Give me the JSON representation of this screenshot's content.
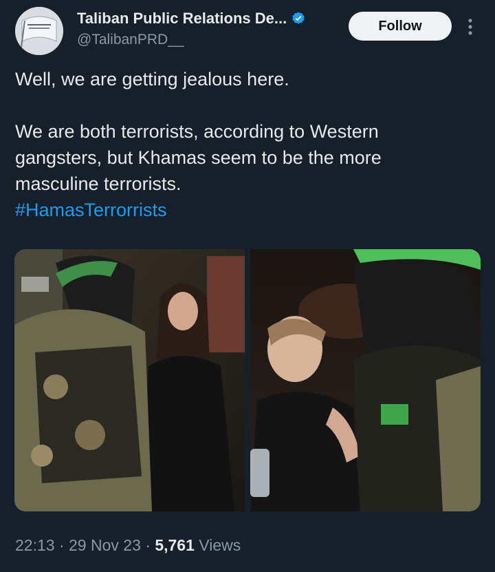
{
  "tweet": {
    "display_name": "Taliban Public Relations De...",
    "handle": "@TalibanPRD__",
    "follow_label": "Follow",
    "paragraphs": [
      "Well, we are getting jealous here.",
      "We are both terrorists, according to Western gangsters, but Khamas seem to be the more masculine terrorists."
    ],
    "hashtag": "#HamasTerrorrists",
    "time": "22:13",
    "date": "29 Nov 23",
    "separator": "·",
    "views_count": "5,761",
    "views_label": "Views"
  },
  "colors": {
    "background": "#15202b",
    "text": "#e7e9ea",
    "muted": "#8b98a5",
    "link": "#1d9bf0",
    "verified": "#1d9bf0"
  },
  "icons": [
    "avatar-flag-icon",
    "verified-badge-icon",
    "more-options-icon"
  ]
}
